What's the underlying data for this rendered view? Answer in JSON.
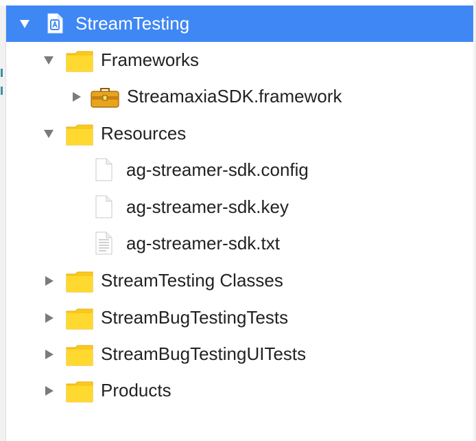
{
  "navigator": {
    "project": {
      "label": "StreamTesting",
      "icon": "xcode-project-icon",
      "expanded": true,
      "selected": true
    },
    "items": [
      {
        "label": "Frameworks",
        "icon": "folder-icon",
        "expanded": true
      },
      {
        "label": "StreamaxiaSDK.framework",
        "icon": "framework-icon",
        "expanded": false
      },
      {
        "label": "Resources",
        "icon": "folder-icon",
        "expanded": true
      },
      {
        "label": "ag-streamer-sdk.config",
        "icon": "file-icon"
      },
      {
        "label": "ag-streamer-sdk.key",
        "icon": "file-icon"
      },
      {
        "label": "ag-streamer-sdk.txt",
        "icon": "text-file-icon"
      },
      {
        "label": "StreamTesting Classes",
        "icon": "folder-icon",
        "expanded": false
      },
      {
        "label": "StreamBugTestingTests",
        "icon": "folder-icon",
        "expanded": false
      },
      {
        "label": "StreamBugTestingUITests",
        "icon": "folder-icon",
        "expanded": false
      },
      {
        "label": "Products",
        "icon": "folder-icon",
        "expanded": false
      }
    ]
  },
  "colors": {
    "selection": "#3f87f5",
    "folder": "#fbcd1a",
    "disclosure": "#7b7b7b",
    "text": "#222222"
  }
}
